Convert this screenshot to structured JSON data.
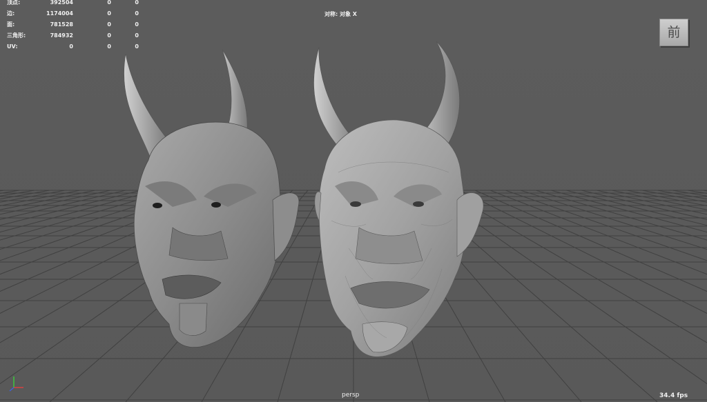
{
  "stats": {
    "rows": [
      {
        "label": "顶点:",
        "v1": "392504",
        "v2": "0",
        "v3": "0"
      },
      {
        "label": "边:",
        "v1": "1174004",
        "v2": "0",
        "v3": "0"
      },
      {
        "label": "面:",
        "v1": "781528",
        "v2": "0",
        "v3": "0"
      },
      {
        "label": "三角形:",
        "v1": "784932",
        "v2": "0",
        "v3": "0"
      },
      {
        "label": "UV:",
        "v1": "0",
        "v2": "0",
        "v3": "0"
      }
    ]
  },
  "viewport": {
    "symmetry_label": "对称: 对象 X",
    "camera": "persp",
    "fps": "34.4 fps",
    "view_cube_label": "前"
  },
  "colors": {
    "background": "#5b5b5b",
    "grid_line": "#3f3f3f",
    "hud_text": "#f0f0f0"
  }
}
